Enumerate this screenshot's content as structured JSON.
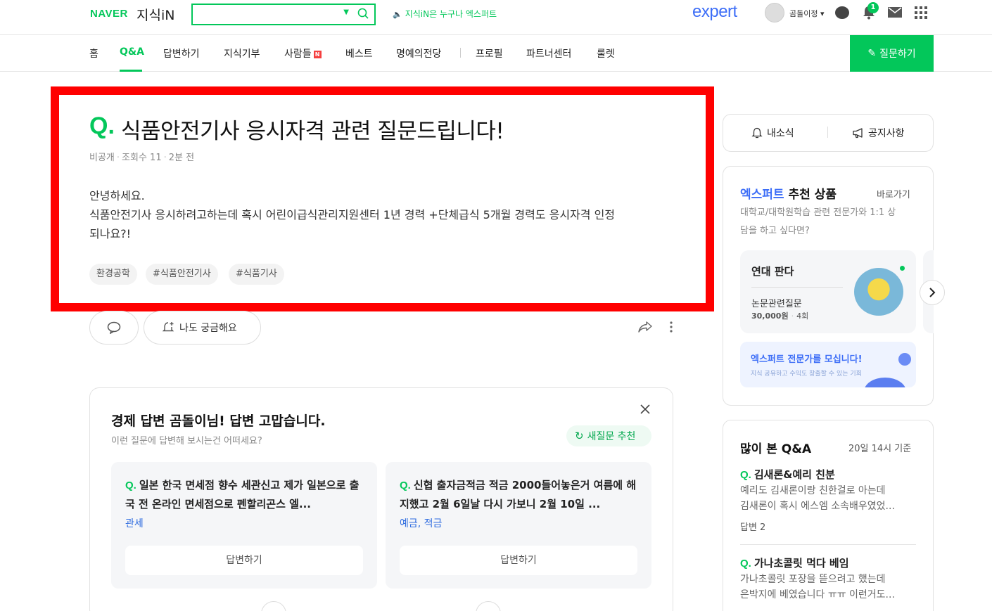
{
  "header": {
    "naver_logo": "NAVER",
    "jisik_logo": "지식iN",
    "search_placeholder": "",
    "notice": "지식iN은 누구나 엑스퍼트",
    "expert_logo": "expert",
    "user_name": "곰돌이정",
    "bell_count": "1"
  },
  "nav": {
    "items": [
      "홈",
      "Q&A",
      "답변하기",
      "지식기부",
      "사람들",
      "베스트",
      "명예의전당",
      "프로필",
      "파트너센터",
      "룰렛"
    ],
    "active": "Q&A",
    "new_badge": "N",
    "ask_button": "질문하기"
  },
  "question": {
    "mark": "Q.",
    "title": "식품안전기사 응시자격 관련 질문드립니다!",
    "author": "비공개",
    "views": "조회수 11",
    "time": "2분 전",
    "body_lines": [
      "안녕하세요.",
      "식품안전기사 응시하려고하는데 혹시 어린이급식관리지원센터 1년 경력 +단체급식 5개월 경력도 응시자격 인정",
      "되나요?!"
    ],
    "tags": [
      "환경공학",
      "#식품안전기사",
      "#식품기사"
    ],
    "curious_button": "나도 궁금해요"
  },
  "recommend": {
    "title": "경제 답변 곰돌이님! 답변 고맙습니다.",
    "subtitle": "이런 질문에 답변해 보시는건 어떠세요?",
    "new_button": "새질문 추천",
    "cards": [
      {
        "question": "일본 한국 면세점 향수 세관신고 제가 일본으로 출국 전 온라인 면세점으로 펜할리곤스 엘...",
        "category": "관세",
        "answer_button": "답변하기"
      },
      {
        "question": "신협 출자금적금 적금 2000들어놓은거 여름에 해지했고 2월 6일날 다시 가보니 2월 10일 ...",
        "category": "예금, 적금",
        "answer_button": "답변하기"
      }
    ]
  },
  "sidebar": {
    "my_news": "내소식",
    "notice": "공지사항",
    "expert": {
      "title_highlight": "엑스퍼트",
      "title_rest": " 추천 상품",
      "goto": "바로가기",
      "desc_line1": "대학교/대학원학습 관련 전문가와 1:1 상",
      "desc_line2": "담을 하고 싶다면?",
      "name": "연대 판다",
      "product": "논문관련질문",
      "price": "30,000원",
      "count": "4회",
      "recruit_title": "엑스퍼트 전문가를 모십니다!",
      "recruit_sub": "지식 공유하고 수익도 창출할 수 있는 기회"
    },
    "popular": {
      "title": "많이 본 Q&A",
      "time": "20일 14시 기준",
      "items": [
        {
          "question": "김새론&예리 친분",
          "line1": "예리도 김새론이랑 친한걸로 아는데",
          "line2": "김새론이 혹시 에스엠 소속배우였었...",
          "answers": "답변 2"
        },
        {
          "question": "가나초콜릿 먹다 베임",
          "line1": "가나초콜릿 포장을 뜯으려고 했는데",
          "line2": "은박지에 베였습니다 ㅠㅠ 이런거도..."
        }
      ]
    }
  },
  "colors": {
    "brand_green": "#03c75a",
    "expert_blue": "#3d6ef7",
    "highlight_red": "#ff0000"
  }
}
